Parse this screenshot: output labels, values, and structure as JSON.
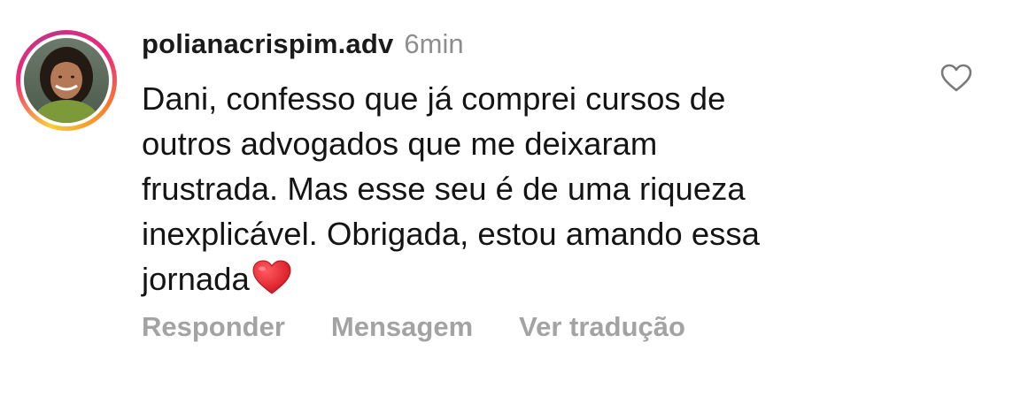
{
  "comment": {
    "username": "polianacrispim.adv",
    "timestamp": "6min",
    "text": "Dani, confesso que já comprei cursos de\noutros advogados que me deixaram\nfrustrada. Mas esse seu é de uma riqueza\ninexplicável. Obrigada, estou amando essa\njornada",
    "emoji": "❤️",
    "avatar_icon": "profile-photo",
    "like_icon": "heart-outline-icon"
  },
  "actions": {
    "reply_label": "Responder",
    "message_label": "Mensagem",
    "translate_label": "Ver tradução"
  },
  "colors": {
    "username": "#1a1a1a",
    "secondary": "#8e8e8e",
    "action_text": "#a3a3a3",
    "emoji_heart": "#e0202b"
  }
}
